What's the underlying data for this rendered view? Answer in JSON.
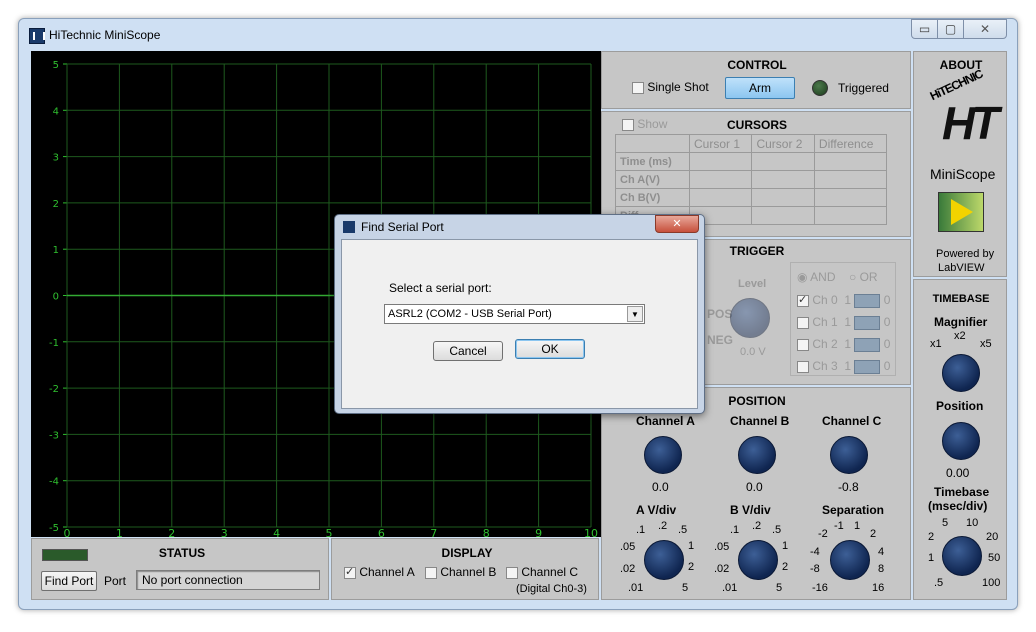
{
  "window": {
    "title": "HiTechnic MiniScope",
    "minimize": "▭",
    "maximize": "▢",
    "close": "✕"
  },
  "scope": {
    "y_ticks": [
      "5",
      "4",
      "3",
      "2",
      "1",
      "0",
      "-1",
      "-2",
      "-3",
      "-4",
      "-5"
    ],
    "x_ticks": [
      "0",
      "1",
      "2",
      "3",
      "4",
      "5",
      "6",
      "7",
      "8",
      "9",
      "10"
    ]
  },
  "status": {
    "title": "STATUS",
    "find_port": "Find Port",
    "port_label": "Port",
    "port_value": "No port connection"
  },
  "display": {
    "title": "DISPLAY",
    "channel_a": "Channel A",
    "channel_b": "Channel B",
    "channel_c": "Channel C",
    "channel_c_note": "(Digital Ch0-3)"
  },
  "control": {
    "title": "CONTROL",
    "single_shot": "Single Shot",
    "arm": "Arm",
    "triggered": "Triggered"
  },
  "cursors": {
    "show": "Show",
    "title": "CURSORS",
    "headers": [
      "Cursor 1",
      "Cursor 2",
      "Difference"
    ],
    "rows": [
      "Time (ms)",
      "Ch A(V)",
      "Ch B(V)",
      "Diff"
    ]
  },
  "trigger": {
    "title": "TRIGGER",
    "pos": "POS",
    "neg": "NEG",
    "level": "Level",
    "level_value": "0.0 V",
    "and": "AND",
    "or": "OR",
    "channels": [
      {
        "name": "Ch 0",
        "one": "1",
        "zero": "0"
      },
      {
        "name": "Ch 1",
        "one": "1",
        "zero": "0"
      },
      {
        "name": "Ch 2",
        "one": "1",
        "zero": "0"
      },
      {
        "name": "Ch 3",
        "one": "1",
        "zero": "0"
      }
    ]
  },
  "position": {
    "title": "POSITION",
    "channel_a": "Channel A",
    "channel_a_value": "0.0",
    "channel_b": "Channel B",
    "channel_b_value": "0.0",
    "channel_c": "Channel C",
    "channel_c_value": "-0.8",
    "a_vdiv": "A V/div",
    "b_vdiv": "B V/div",
    "separation": "Separation",
    "vdiv_scale": [
      ".01",
      ".02",
      ".05",
      ".1",
      ".2",
      ".5",
      "1",
      "2",
      "5"
    ],
    "sep_scale": [
      "-16",
      "-8",
      "-4",
      "-2",
      "-1",
      "1",
      "2",
      "4",
      "8",
      "16"
    ]
  },
  "about": {
    "title": "ABOUT",
    "logo_text": "HiTECHNIC",
    "product": "MiniScope",
    "powered": "Powered by",
    "labview": "LabVIEW"
  },
  "timebase": {
    "title": "TIMEBASE",
    "magnifier": "Magnifier",
    "x1": "x1",
    "x2": "x2",
    "x5": "x5",
    "position": "Position",
    "position_value": "0.00",
    "timebase_label": "Timebase",
    "timebase_unit": "(msec/div)",
    "scale": [
      ".5",
      "1",
      "2",
      "5",
      "10",
      "20",
      "50",
      "100"
    ]
  },
  "dialog": {
    "title": "Find Serial Port",
    "close": "✕",
    "prompt": "Select a serial port:",
    "selected": "ASRL2  (COM2 - USB Serial Port)",
    "cancel": "Cancel",
    "ok": "OK"
  },
  "colors": {
    "grid": "#1e5a1e",
    "trace": "#33aa33",
    "axis_text": "#2fbf2f",
    "accent_button": "#8fc8f2",
    "knob": "#1b3a72",
    "led_off": "#2a5a2a"
  }
}
